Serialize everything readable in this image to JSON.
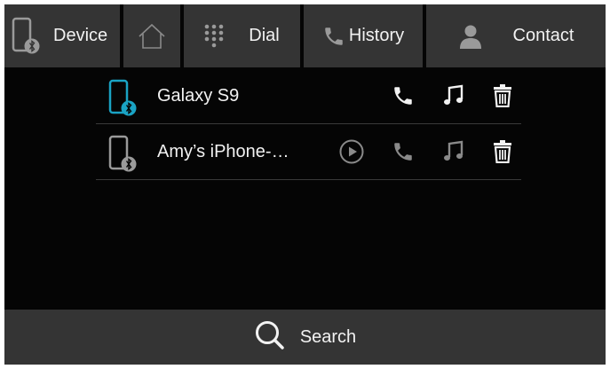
{
  "tabs": {
    "device": {
      "label": "Device",
      "icon": "phone-bluetooth-icon"
    },
    "home": {
      "icon": "home-icon"
    },
    "dial": {
      "label": "Dial",
      "icon": "dialpad-icon"
    },
    "history": {
      "label": "History",
      "icon": "phone-icon"
    },
    "contact": {
      "label": "Contact",
      "icon": "person-icon"
    }
  },
  "devices": [
    {
      "name": "Galaxy S9",
      "connected": true,
      "actions": [
        "phone-icon",
        "music-note-icon",
        "trash-icon"
      ]
    },
    {
      "name": "Amy’s iPhone-…",
      "connected": false,
      "actions": [
        "play-icon",
        "phone-icon",
        "music-note-icon",
        "trash-icon"
      ]
    }
  ],
  "search": {
    "label": "Search",
    "icon": "search-icon"
  },
  "colors": {
    "background": "#050505",
    "bar": "#343434",
    "text": "#f2f2f2",
    "accent_connected": "#1aa3c4",
    "inactive": "#8a8a8a",
    "divider": "#3a3a3a"
  }
}
